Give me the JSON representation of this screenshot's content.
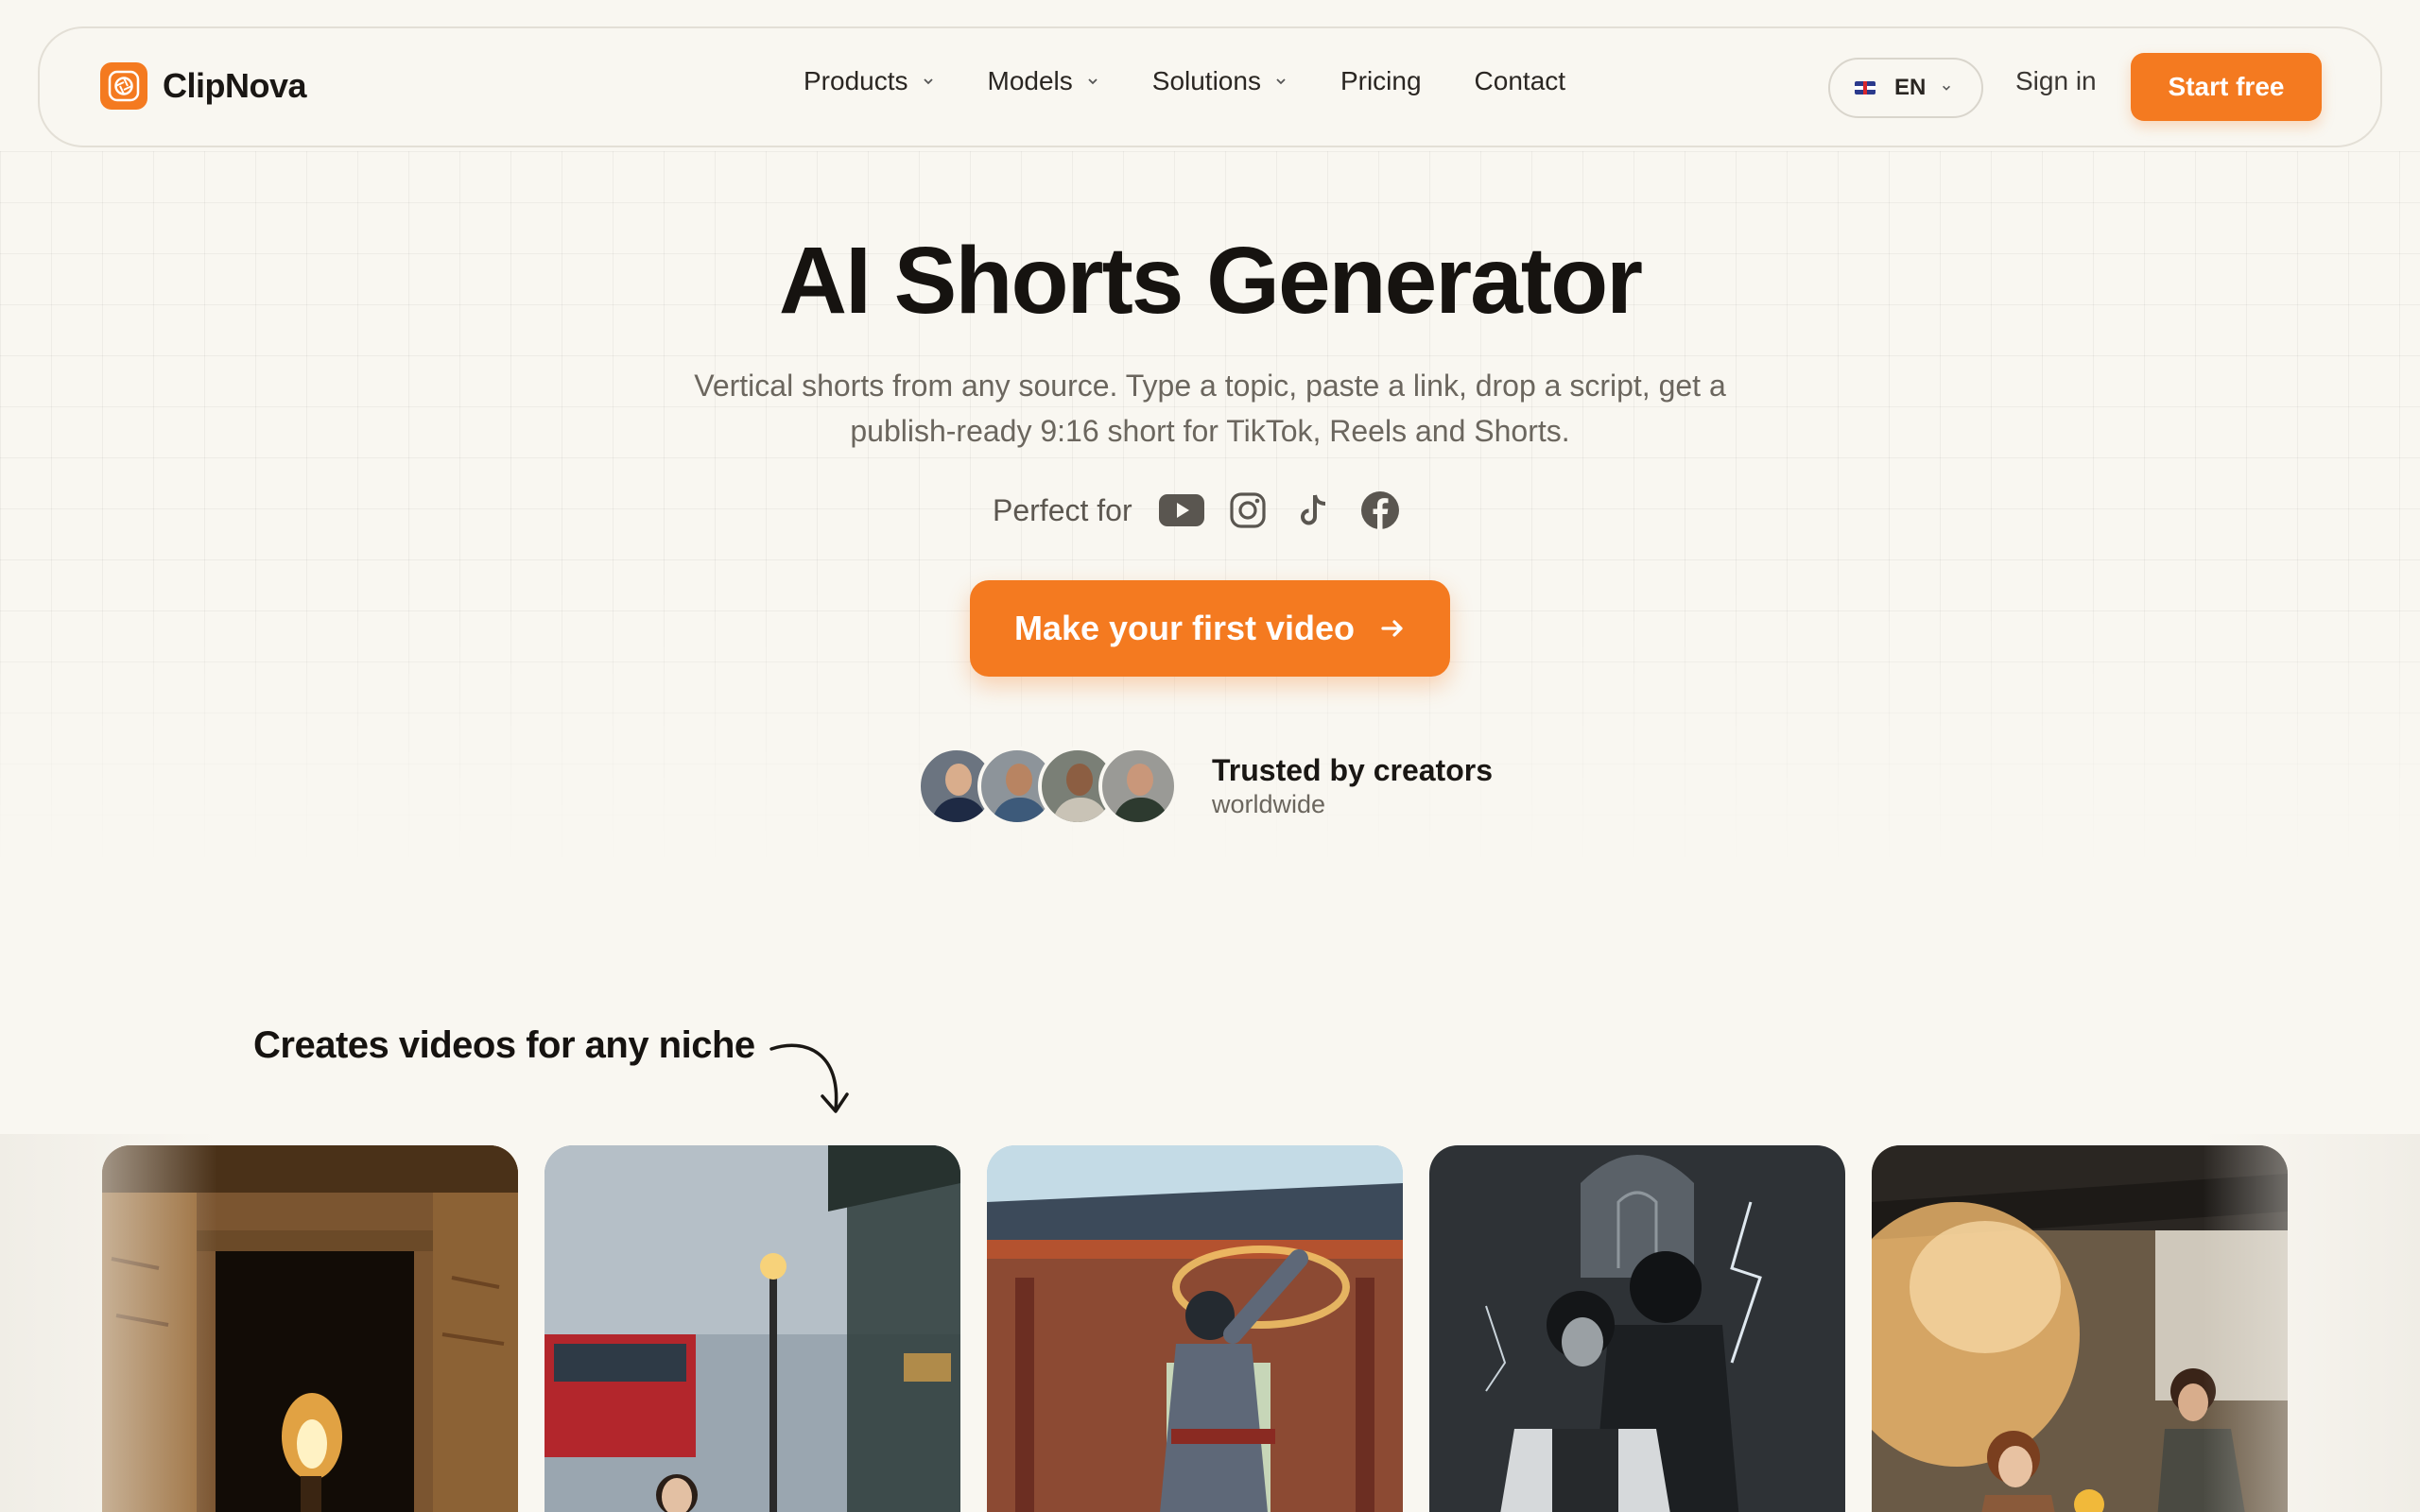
{
  "brand": {
    "name": "ClipNova",
    "accent": "#f47a20"
  },
  "nav": {
    "items": [
      {
        "label": "Products",
        "has_dropdown": true
      },
      {
        "label": "Models",
        "has_dropdown": true
      },
      {
        "label": "Solutions",
        "has_dropdown": true
      },
      {
        "label": "Pricing",
        "has_dropdown": false
      },
      {
        "label": "Contact",
        "has_dropdown": false
      }
    ],
    "language": "EN",
    "sign_in": "Sign in",
    "start_free": "Start free"
  },
  "hero": {
    "title": "AI Shorts Generator",
    "subtitle": "Vertical shorts from any source. Type a topic, paste a link, drop a script, get a publish-ready 9:16 short for TikTok, Reels and Shorts.",
    "perfect_for_label": "Perfect for",
    "platforms": [
      "youtube-icon",
      "instagram-icon",
      "tiktok-icon",
      "facebook-icon"
    ],
    "cta": "Make your first video",
    "trust_title": "Trusted by creators",
    "trust_sub": "worldwide"
  },
  "niche": {
    "title": "Creates videos for any niche",
    "cards": [
      {
        "scene": "torch-in-ancient-tomb"
      },
      {
        "scene": "woman-at-rainy-bus-stop"
      },
      {
        "scene": "anime-martial-artist-at-temple"
      },
      {
        "scene": "gothic-dark-fantasy-figures"
      },
      {
        "scene": "steam-train-station-crowd"
      }
    ]
  }
}
